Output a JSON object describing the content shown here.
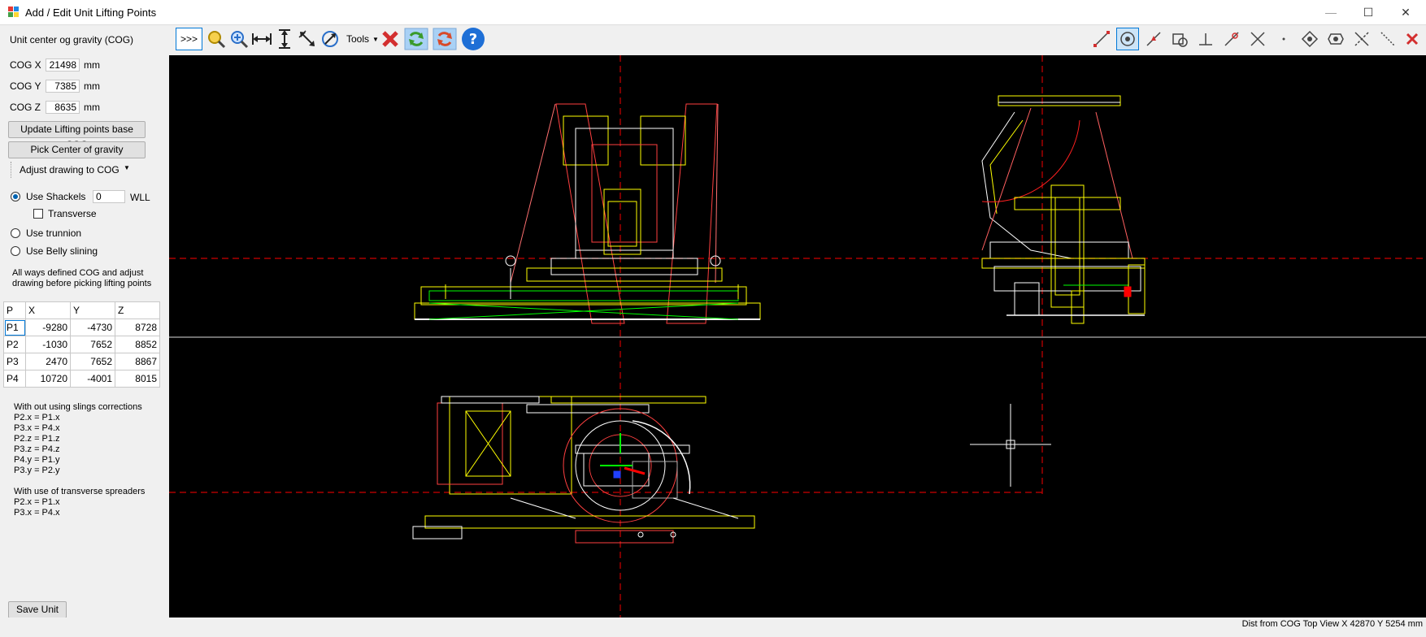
{
  "window": {
    "title": "Add / Edit Unit Lifting Points",
    "minimize_glyph": "—",
    "maximize_glyph": "☐",
    "close_glyph": "✕"
  },
  "left_panel": {
    "section_title": "Unit center og gravity (COG)",
    "cog_x": {
      "label": "COG X",
      "value": "21498",
      "unit": "mm"
    },
    "cog_y": {
      "label": "COG Y",
      "value": "7385",
      "unit": "mm"
    },
    "cog_z": {
      "label": "COG Z",
      "value": "8635",
      "unit": "mm"
    },
    "update_button": "Update Lifting points base COG",
    "pick_button": "Pick Center of gravity",
    "adjust_dropdown": "Adjust drawing to COG",
    "use_shackels": {
      "label": "Use Shackels",
      "selected": true
    },
    "wll": {
      "value": "0",
      "unit": "WLL"
    },
    "transverse": {
      "label": "Transverse",
      "checked": false
    },
    "use_trunnion": {
      "label": "Use  trunnion",
      "selected": false
    },
    "use_belly": {
      "label": "Use Belly slining",
      "selected": false
    },
    "hint_line1": "All ways defined COG and adjust",
    "hint_line2": "drawing before picking lifting points",
    "table": {
      "headers": [
        "P",
        "X",
        "Y",
        "Z"
      ],
      "rows": [
        [
          "P1",
          "-9280",
          "-4730",
          "8728"
        ],
        [
          "P2",
          "-1030",
          "7652",
          "8852"
        ],
        [
          "P3",
          "2470",
          "7652",
          "8867"
        ],
        [
          "P4",
          "10720",
          "-4001",
          "8015"
        ]
      ]
    },
    "corrections_title": "With out using slings corrections",
    "corrections": [
      "P2.x = P1.x",
      "P3.x = P4.x",
      "P2.z = P1.z",
      "P3.z = P4.z",
      "P4.y = P1.y",
      "P3.y = P2.y"
    ],
    "spreaders_title": "With use of transverse spreaders",
    "spreaders": [
      "P2.x = P1.x",
      "P3.x = P4.x"
    ],
    "save_button": "Save Unit"
  },
  "toolbar": {
    "expand_label": ">>>",
    "tools_label": "Tools",
    "left_icons": [
      "zoom-icon",
      "zoom-window-icon",
      "measure-horizontal-icon",
      "measure-vertical-icon",
      "measure-aligned-icon",
      "rotate-icon",
      "delete-icon",
      "refresh-icon",
      "refresh-alt-icon",
      "help-icon"
    ],
    "snap_icons": [
      "snap-endpoint-icon",
      "snap-center-icon",
      "snap-midpoint-icon",
      "snap-quadrant-icon",
      "snap-perpendicular-icon",
      "snap-tangent-icon",
      "snap-intersection-icon",
      "snap-node-icon",
      "snap-insert-icon",
      "snap-nearest-icon",
      "snap-apparent-intersection-icon",
      "snap-extension-icon",
      "snap-clear-icon"
    ]
  },
  "colors": {
    "canvas": "#000000",
    "drawing_white": "#ffffff",
    "drawing_yellow": "#ffff00",
    "drawing_red": "#ff0000",
    "drawing_green": "#00ff00",
    "cog_line": "#cc0000",
    "accent": "#0078d7"
  },
  "status_bar": {
    "text": "Dist from COG Top View X 42870 Y 5254 mm"
  }
}
